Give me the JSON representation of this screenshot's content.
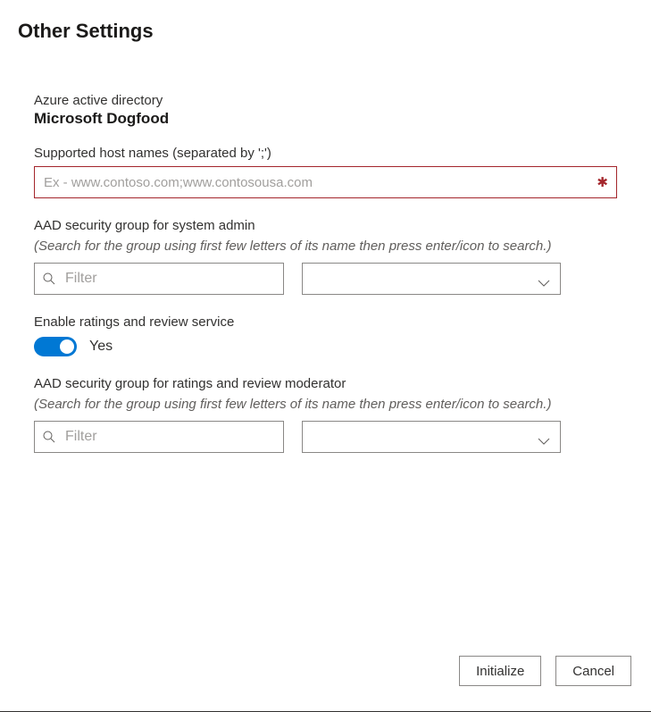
{
  "header": {
    "title": "Other Settings"
  },
  "directory": {
    "label": "Azure active directory",
    "name": "Microsoft Dogfood"
  },
  "hostnames": {
    "label": "Supported host names (separated by ';')",
    "placeholder": "Ex - www.contoso.com;www.contosousa.com",
    "value": "",
    "required_glyph": "✱"
  },
  "admin_group": {
    "label": "AAD security group for system admin",
    "hint": "(Search for the group using first few letters of its name then press enter/icon to search.)",
    "filter_placeholder": "Filter",
    "filter_value": "",
    "select_value": ""
  },
  "ratings_toggle": {
    "label": "Enable ratings and review service",
    "state_text": "Yes",
    "on": true
  },
  "moderator_group": {
    "label": "AAD security group for ratings and review moderator",
    "hint": "(Search for the group using first few letters of its name then press enter/icon to search.)",
    "filter_placeholder": "Filter",
    "filter_value": "",
    "select_value": ""
  },
  "footer": {
    "initialize": "Initialize",
    "cancel": "Cancel"
  }
}
